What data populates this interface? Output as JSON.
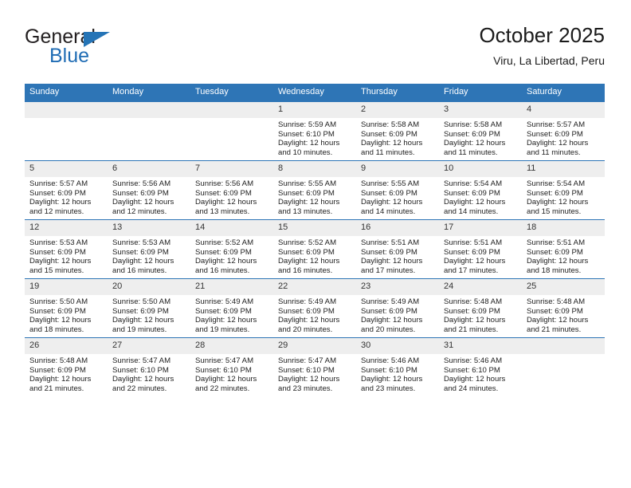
{
  "brand": {
    "name_part1": "General",
    "name_part2": "Blue",
    "flag_icon": "triangle-flag-icon"
  },
  "header": {
    "title": "October 2025",
    "subtitle": "Viru, La Libertad, Peru"
  },
  "colors": {
    "header_blue": "#2e75b6",
    "brand_blue": "#1f6cb4",
    "daynum_band": "#eeeeee",
    "text": "#222222"
  },
  "weekday_headers": [
    "Sunday",
    "Monday",
    "Tuesday",
    "Wednesday",
    "Thursday",
    "Friday",
    "Saturday"
  ],
  "labels": {
    "sunrise_prefix": "Sunrise:",
    "sunset_prefix": "Sunset:",
    "daylight_prefix": "Daylight:"
  },
  "weeks": [
    [
      {
        "day": "",
        "empty": true,
        "sunrise": "",
        "sunset": "",
        "daylight1": "",
        "daylight2": ""
      },
      {
        "day": "",
        "empty": true,
        "sunrise": "",
        "sunset": "",
        "daylight1": "",
        "daylight2": ""
      },
      {
        "day": "",
        "empty": true,
        "sunrise": "",
        "sunset": "",
        "daylight1": "",
        "daylight2": ""
      },
      {
        "day": "1",
        "empty": false,
        "sunrise": "Sunrise: 5:59 AM",
        "sunset": "Sunset: 6:10 PM",
        "daylight1": "Daylight: 12 hours",
        "daylight2": "and 10 minutes."
      },
      {
        "day": "2",
        "empty": false,
        "sunrise": "Sunrise: 5:58 AM",
        "sunset": "Sunset: 6:09 PM",
        "daylight1": "Daylight: 12 hours",
        "daylight2": "and 11 minutes."
      },
      {
        "day": "3",
        "empty": false,
        "sunrise": "Sunrise: 5:58 AM",
        "sunset": "Sunset: 6:09 PM",
        "daylight1": "Daylight: 12 hours",
        "daylight2": "and 11 minutes."
      },
      {
        "day": "4",
        "empty": false,
        "sunrise": "Sunrise: 5:57 AM",
        "sunset": "Sunset: 6:09 PM",
        "daylight1": "Daylight: 12 hours",
        "daylight2": "and 11 minutes."
      }
    ],
    [
      {
        "day": "5",
        "empty": false,
        "sunrise": "Sunrise: 5:57 AM",
        "sunset": "Sunset: 6:09 PM",
        "daylight1": "Daylight: 12 hours",
        "daylight2": "and 12 minutes."
      },
      {
        "day": "6",
        "empty": false,
        "sunrise": "Sunrise: 5:56 AM",
        "sunset": "Sunset: 6:09 PM",
        "daylight1": "Daylight: 12 hours",
        "daylight2": "and 12 minutes."
      },
      {
        "day": "7",
        "empty": false,
        "sunrise": "Sunrise: 5:56 AM",
        "sunset": "Sunset: 6:09 PM",
        "daylight1": "Daylight: 12 hours",
        "daylight2": "and 13 minutes."
      },
      {
        "day": "8",
        "empty": false,
        "sunrise": "Sunrise: 5:55 AM",
        "sunset": "Sunset: 6:09 PM",
        "daylight1": "Daylight: 12 hours",
        "daylight2": "and 13 minutes."
      },
      {
        "day": "9",
        "empty": false,
        "sunrise": "Sunrise: 5:55 AM",
        "sunset": "Sunset: 6:09 PM",
        "daylight1": "Daylight: 12 hours",
        "daylight2": "and 14 minutes."
      },
      {
        "day": "10",
        "empty": false,
        "sunrise": "Sunrise: 5:54 AM",
        "sunset": "Sunset: 6:09 PM",
        "daylight1": "Daylight: 12 hours",
        "daylight2": "and 14 minutes."
      },
      {
        "day": "11",
        "empty": false,
        "sunrise": "Sunrise: 5:54 AM",
        "sunset": "Sunset: 6:09 PM",
        "daylight1": "Daylight: 12 hours",
        "daylight2": "and 15 minutes."
      }
    ],
    [
      {
        "day": "12",
        "empty": false,
        "sunrise": "Sunrise: 5:53 AM",
        "sunset": "Sunset: 6:09 PM",
        "daylight1": "Daylight: 12 hours",
        "daylight2": "and 15 minutes."
      },
      {
        "day": "13",
        "empty": false,
        "sunrise": "Sunrise: 5:53 AM",
        "sunset": "Sunset: 6:09 PM",
        "daylight1": "Daylight: 12 hours",
        "daylight2": "and 16 minutes."
      },
      {
        "day": "14",
        "empty": false,
        "sunrise": "Sunrise: 5:52 AM",
        "sunset": "Sunset: 6:09 PM",
        "daylight1": "Daylight: 12 hours",
        "daylight2": "and 16 minutes."
      },
      {
        "day": "15",
        "empty": false,
        "sunrise": "Sunrise: 5:52 AM",
        "sunset": "Sunset: 6:09 PM",
        "daylight1": "Daylight: 12 hours",
        "daylight2": "and 16 minutes."
      },
      {
        "day": "16",
        "empty": false,
        "sunrise": "Sunrise: 5:51 AM",
        "sunset": "Sunset: 6:09 PM",
        "daylight1": "Daylight: 12 hours",
        "daylight2": "and 17 minutes."
      },
      {
        "day": "17",
        "empty": false,
        "sunrise": "Sunrise: 5:51 AM",
        "sunset": "Sunset: 6:09 PM",
        "daylight1": "Daylight: 12 hours",
        "daylight2": "and 17 minutes."
      },
      {
        "day": "18",
        "empty": false,
        "sunrise": "Sunrise: 5:51 AM",
        "sunset": "Sunset: 6:09 PM",
        "daylight1": "Daylight: 12 hours",
        "daylight2": "and 18 minutes."
      }
    ],
    [
      {
        "day": "19",
        "empty": false,
        "sunrise": "Sunrise: 5:50 AM",
        "sunset": "Sunset: 6:09 PM",
        "daylight1": "Daylight: 12 hours",
        "daylight2": "and 18 minutes."
      },
      {
        "day": "20",
        "empty": false,
        "sunrise": "Sunrise: 5:50 AM",
        "sunset": "Sunset: 6:09 PM",
        "daylight1": "Daylight: 12 hours",
        "daylight2": "and 19 minutes."
      },
      {
        "day": "21",
        "empty": false,
        "sunrise": "Sunrise: 5:49 AM",
        "sunset": "Sunset: 6:09 PM",
        "daylight1": "Daylight: 12 hours",
        "daylight2": "and 19 minutes."
      },
      {
        "day": "22",
        "empty": false,
        "sunrise": "Sunrise: 5:49 AM",
        "sunset": "Sunset: 6:09 PM",
        "daylight1": "Daylight: 12 hours",
        "daylight2": "and 20 minutes."
      },
      {
        "day": "23",
        "empty": false,
        "sunrise": "Sunrise: 5:49 AM",
        "sunset": "Sunset: 6:09 PM",
        "daylight1": "Daylight: 12 hours",
        "daylight2": "and 20 minutes."
      },
      {
        "day": "24",
        "empty": false,
        "sunrise": "Sunrise: 5:48 AM",
        "sunset": "Sunset: 6:09 PM",
        "daylight1": "Daylight: 12 hours",
        "daylight2": "and 21 minutes."
      },
      {
        "day": "25",
        "empty": false,
        "sunrise": "Sunrise: 5:48 AM",
        "sunset": "Sunset: 6:09 PM",
        "daylight1": "Daylight: 12 hours",
        "daylight2": "and 21 minutes."
      }
    ],
    [
      {
        "day": "26",
        "empty": false,
        "sunrise": "Sunrise: 5:48 AM",
        "sunset": "Sunset: 6:09 PM",
        "daylight1": "Daylight: 12 hours",
        "daylight2": "and 21 minutes."
      },
      {
        "day": "27",
        "empty": false,
        "sunrise": "Sunrise: 5:47 AM",
        "sunset": "Sunset: 6:10 PM",
        "daylight1": "Daylight: 12 hours",
        "daylight2": "and 22 minutes."
      },
      {
        "day": "28",
        "empty": false,
        "sunrise": "Sunrise: 5:47 AM",
        "sunset": "Sunset: 6:10 PM",
        "daylight1": "Daylight: 12 hours",
        "daylight2": "and 22 minutes."
      },
      {
        "day": "29",
        "empty": false,
        "sunrise": "Sunrise: 5:47 AM",
        "sunset": "Sunset: 6:10 PM",
        "daylight1": "Daylight: 12 hours",
        "daylight2": "and 23 minutes."
      },
      {
        "day": "30",
        "empty": false,
        "sunrise": "Sunrise: 5:46 AM",
        "sunset": "Sunset: 6:10 PM",
        "daylight1": "Daylight: 12 hours",
        "daylight2": "and 23 minutes."
      },
      {
        "day": "31",
        "empty": false,
        "sunrise": "Sunrise: 5:46 AM",
        "sunset": "Sunset: 6:10 PM",
        "daylight1": "Daylight: 12 hours",
        "daylight2": "and 24 minutes."
      },
      {
        "day": "",
        "empty": true,
        "sunrise": "",
        "sunset": "",
        "daylight1": "",
        "daylight2": ""
      }
    ]
  ]
}
